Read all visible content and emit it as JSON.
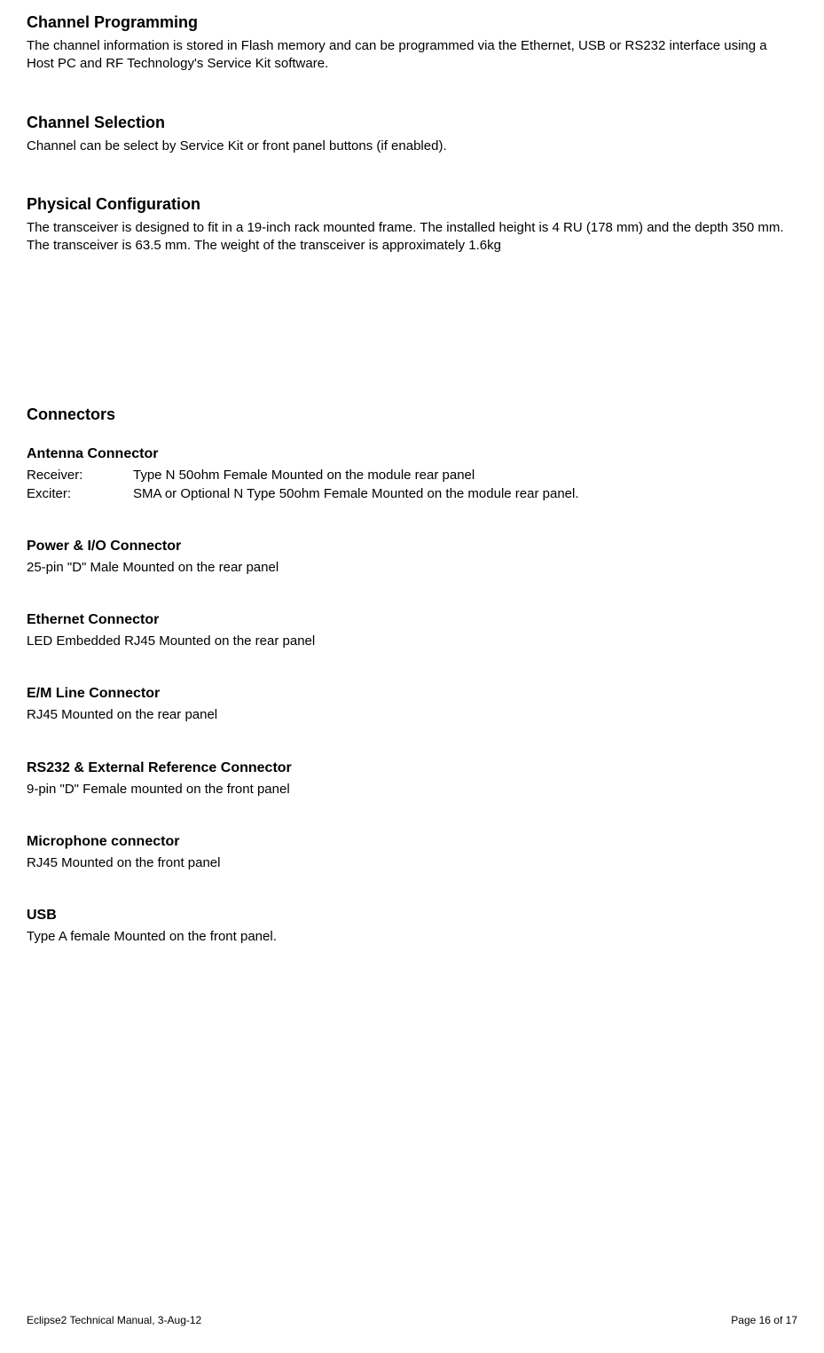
{
  "sections": {
    "channel_programming": {
      "title": "Channel Programming",
      "body": "The channel information is stored in Flash memory and can be programmed via the Ethernet, USB or RS232 interface using a Host PC and RF Technology's Service Kit software."
    },
    "channel_selection": {
      "title": "Channel Selection",
      "body": "Channel can be select by Service Kit or front panel buttons (if enabled)."
    },
    "physical_configuration": {
      "title": "Physical Configuration",
      "body": "The transceiver is designed to fit in a 19-inch rack mounted frame. The installed height is 4 RU (178 mm) and the depth 350 mm. The transceiver is 63.5 mm. The weight of the transceiver is approximately 1.6kg"
    },
    "connectors": {
      "title": "Connectors",
      "antenna": {
        "title": "Antenna Connector",
        "receiver_label": "Receiver:",
        "receiver_value": "Type N 50ohm Female Mounted on the module rear panel",
        "exciter_label": "Exciter:",
        "exciter_value": "SMA or Optional N Type 50ohm Female Mounted on the module rear panel."
      },
      "power_io": {
        "title": "Power & I/O Connector",
        "body": "25-pin \"D\" Male Mounted on the rear panel"
      },
      "ethernet": {
        "title": "Ethernet Connector",
        "body": "LED Embedded RJ45 Mounted on the rear panel"
      },
      "em_line": {
        "title": "E/M Line Connector",
        "body": "RJ45 Mounted on the rear panel"
      },
      "rs232": {
        "title": "RS232 & External Reference Connector",
        "body": "9-pin \"D\" Female mounted on the front panel"
      },
      "microphone": {
        "title": "Microphone connector",
        "body": "RJ45 Mounted on the front panel"
      },
      "usb": {
        "title": "USB",
        "body": "Type A female Mounted on the front panel."
      }
    }
  },
  "footer": {
    "left": "Eclipse2 Technical Manual, 3-Aug-12",
    "right": "Page 16 of 17"
  }
}
